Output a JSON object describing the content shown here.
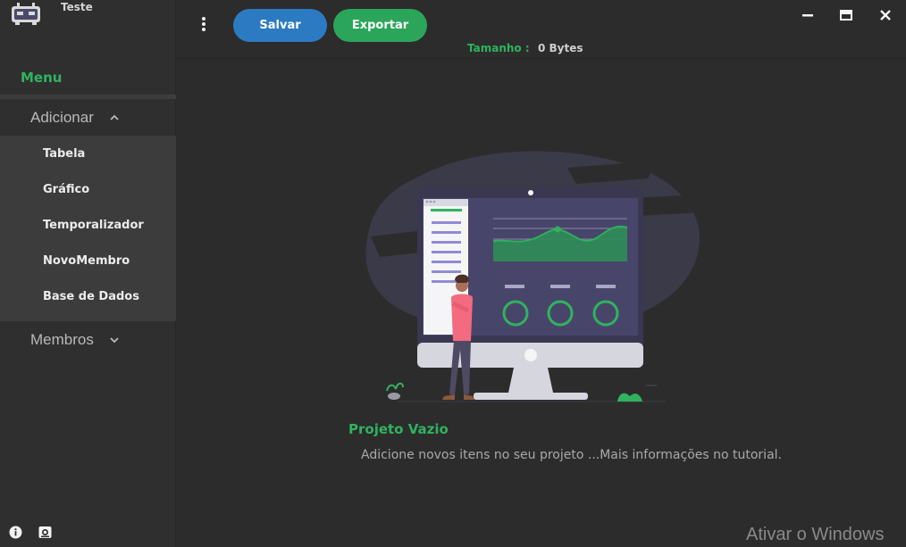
{
  "app": {
    "title": "Teste",
    "logo_icon": "robot-icon"
  },
  "sidebar": {
    "menu_label": "Menu",
    "groups": [
      {
        "label": "Adicionar",
        "expanded": true,
        "chevron_icon": "chevron-up-icon",
        "items": [
          {
            "label": "Tabela"
          },
          {
            "label": "Gráfico"
          },
          {
            "label": "Temporalizador"
          },
          {
            "label": "NovoMembro"
          },
          {
            "label": "Base de Dados"
          }
        ]
      },
      {
        "label": "Membros",
        "expanded": false,
        "chevron_icon": "chevron-down-icon",
        "items": []
      }
    ],
    "footer_icons": [
      "info-icon",
      "camera-icon"
    ]
  },
  "toolbar": {
    "menu_icon": "kebab-menu-icon",
    "save_label": "Salvar",
    "export_label": "Exportar",
    "size_label": "Tamanho :",
    "size_value": "0 Bytes"
  },
  "window_controls": [
    "minimize-icon",
    "maximize-icon",
    "close-icon"
  ],
  "main": {
    "illustration": "dashboard-monitor-illustration",
    "empty_title": "Projeto Vazio",
    "empty_description": "Adicione novos itens no seu projeto ...Mais informações no tutorial."
  },
  "watermark": "Ativar o Windows",
  "colors": {
    "accent_green": "#2fb35f",
    "save_blue": "#2c7bc2",
    "export_green": "#2ba55a",
    "background": "#2c2c2c",
    "sidebar": "#2f2f2f",
    "submenu": "#3c3c3c"
  }
}
